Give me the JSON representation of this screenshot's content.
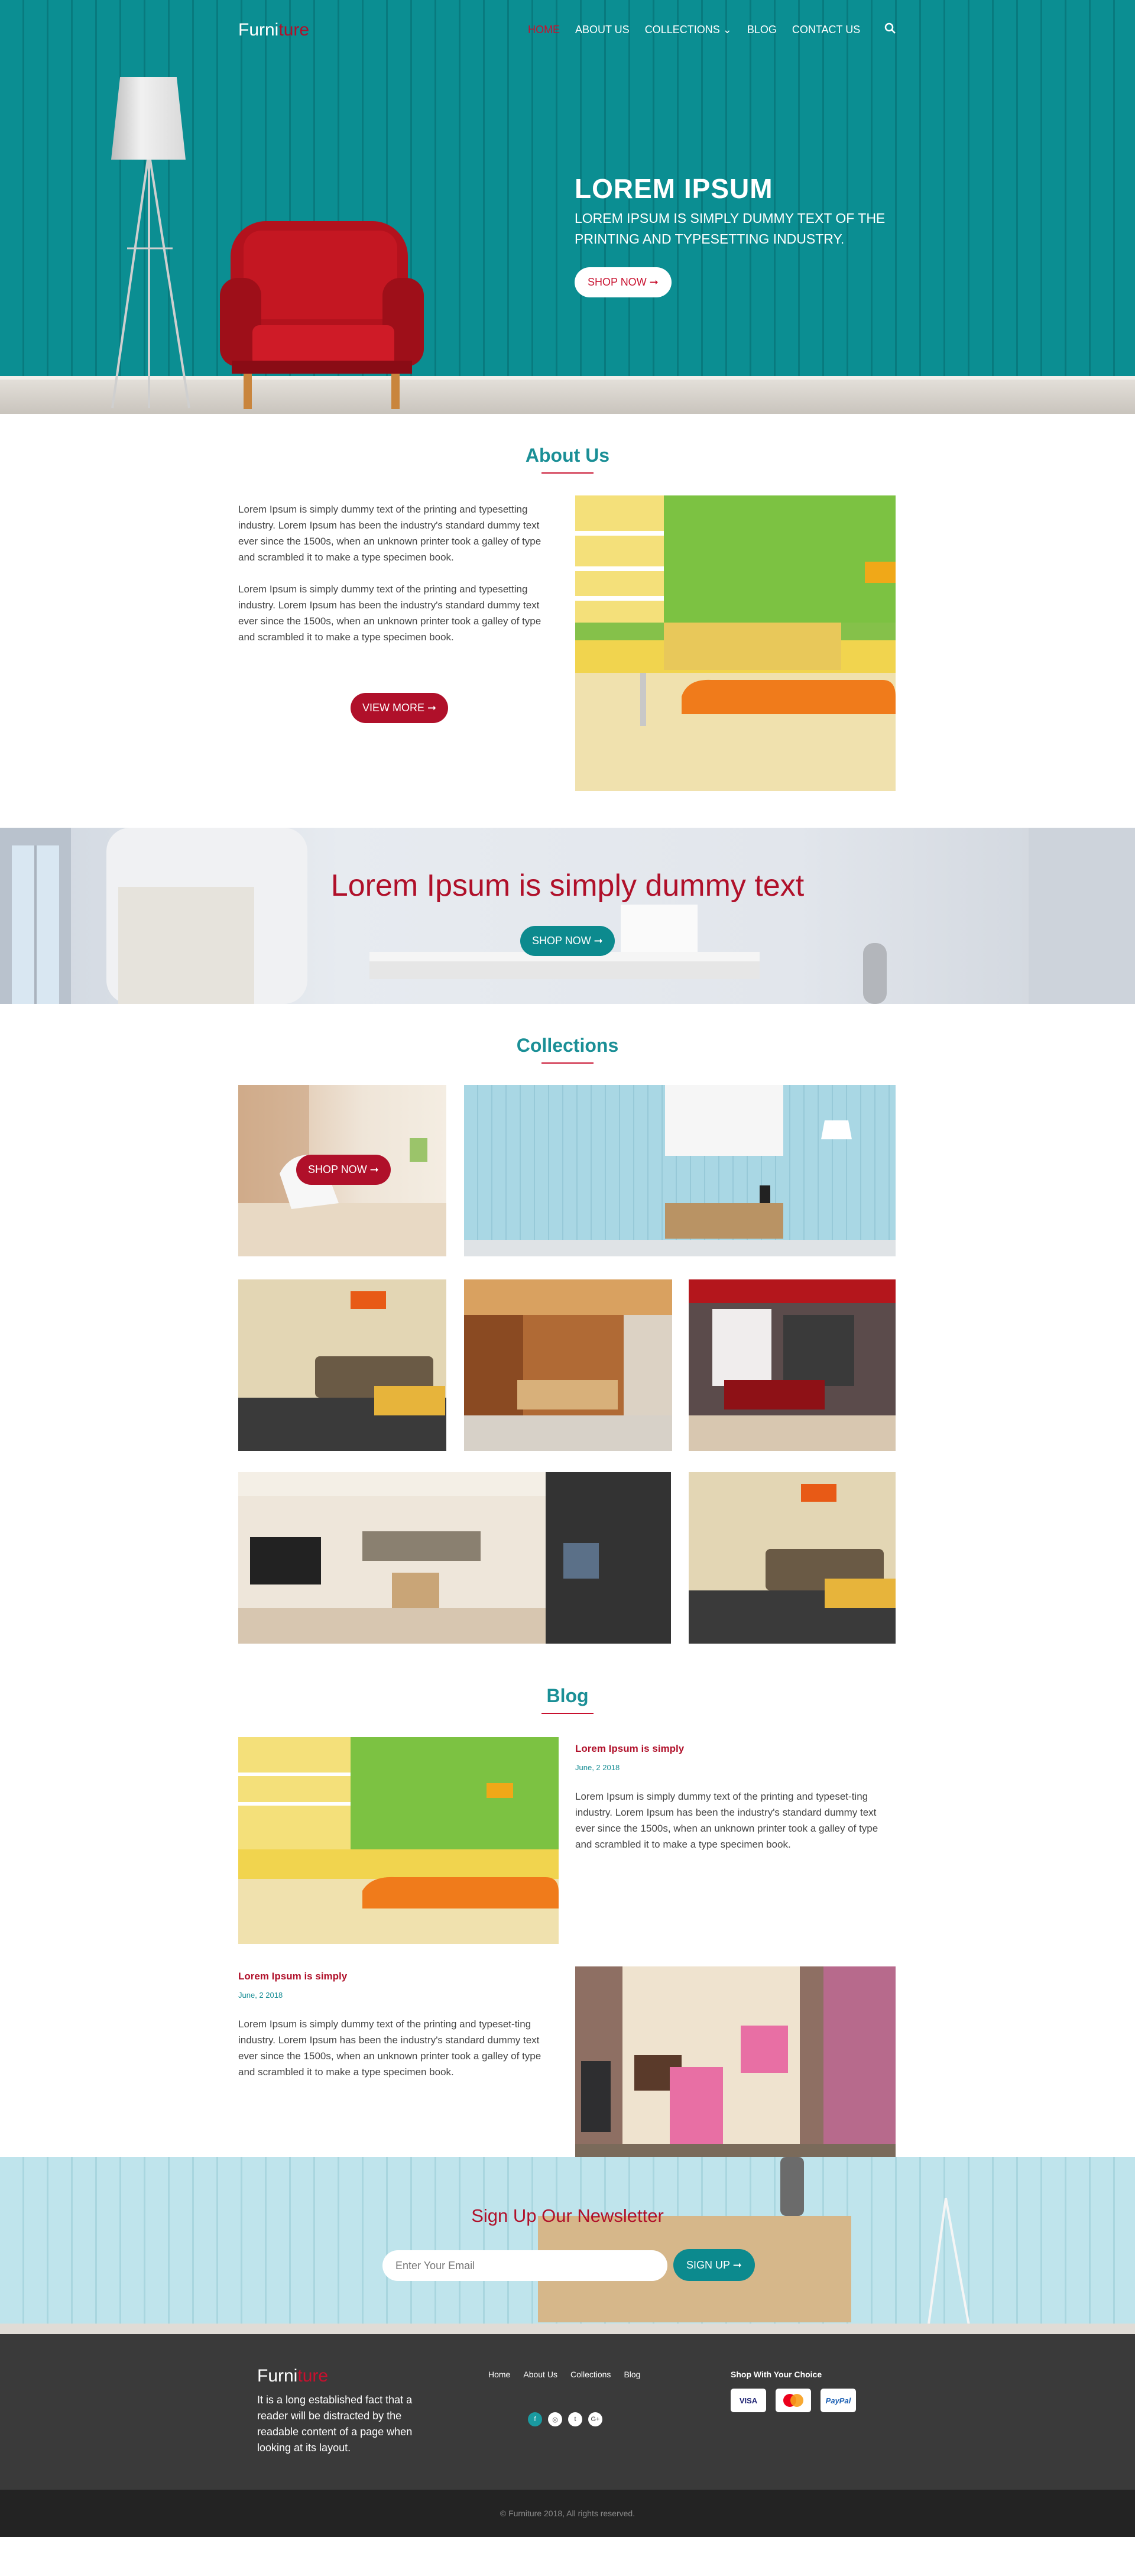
{
  "brand": {
    "logo_part1": "Furni",
    "logo_part2": "ture"
  },
  "nav": {
    "items": [
      "HOME",
      "ABOUT US",
      "COLLECTIONS",
      "BLOG",
      "CONTACT US"
    ],
    "active": "HOME",
    "dropdown_icon": "chevron-down-icon",
    "search_icon": "search-icon"
  },
  "hero": {
    "title": "LOREM IPSUM",
    "subtitle": "LOREM IPSUM IS SIMPLY DUMMY TEXT OF THE PRINTING AND TYPESETTING INDUSTRY.",
    "button": "SHOP NOW ➞"
  },
  "about": {
    "title": "About Us",
    "paragraph1": "Lorem Ipsum is simply dummy text of the printing and typesetting industry. Lorem Ipsum has been the industry's standard dummy text ever since the 1500s, when an unknown printer took a galley of type and scrambled it to make a type specimen book.",
    "paragraph2": "Lorem Ipsum is simply dummy text of the printing and typesetting industry. Lorem Ipsum has been the industry's standard dummy text ever since the 1500s, when an unknown printer took a galley of type and scrambled it to make a type specimen book.",
    "button": "VIEW MORE ➞"
  },
  "banner": {
    "heading": "Lorem Ipsum is simply dummy text",
    "button": "SHOP NOW ➞"
  },
  "collections": {
    "title": "Collections",
    "button": "SHOP NOW ➞"
  },
  "blog": {
    "title": "Blog",
    "posts": [
      {
        "title": "Lorem Ipsum is simply",
        "date": "June, 2 2018",
        "text": "Lorem Ipsum is simply dummy text of the printing and typeset-ting industry. Lorem Ipsum has been the industry's standard dummy text ever since the 1500s, when an unknown printer took a galley of type and scrambled it to make a type specimen book."
      },
      {
        "title": "Lorem Ipsum is simply",
        "date": "June, 2 2018",
        "text": "Lorem Ipsum is simply dummy text of the printing and typeset-ting industry. Lorem Ipsum has been the industry's standard dummy text ever since the 1500s, when an unknown printer took a galley of type and scrambled it to make a type specimen book."
      }
    ]
  },
  "newsletter": {
    "title": "Sign Up Our Newsletter",
    "placeholder": "Enter Your Email",
    "button": "SIGN UP ➞"
  },
  "footer": {
    "about": "It is a long established fact that a reader will be distracted by the readable content of a page when looking at its layout.",
    "links": [
      "Home",
      "About Us",
      "Collections",
      "Blog"
    ],
    "social": [
      "f",
      "◎",
      "t",
      "G+"
    ],
    "payment_title": "Shop With Your Choice",
    "payments": [
      "VISA",
      "MC",
      "PayPal"
    ],
    "copyright": "© Furniture 2018, All rights reserved."
  },
  "colors": {
    "teal": "#0c8a8e",
    "red": "#b0102a",
    "footer": "#3a3a3a"
  }
}
